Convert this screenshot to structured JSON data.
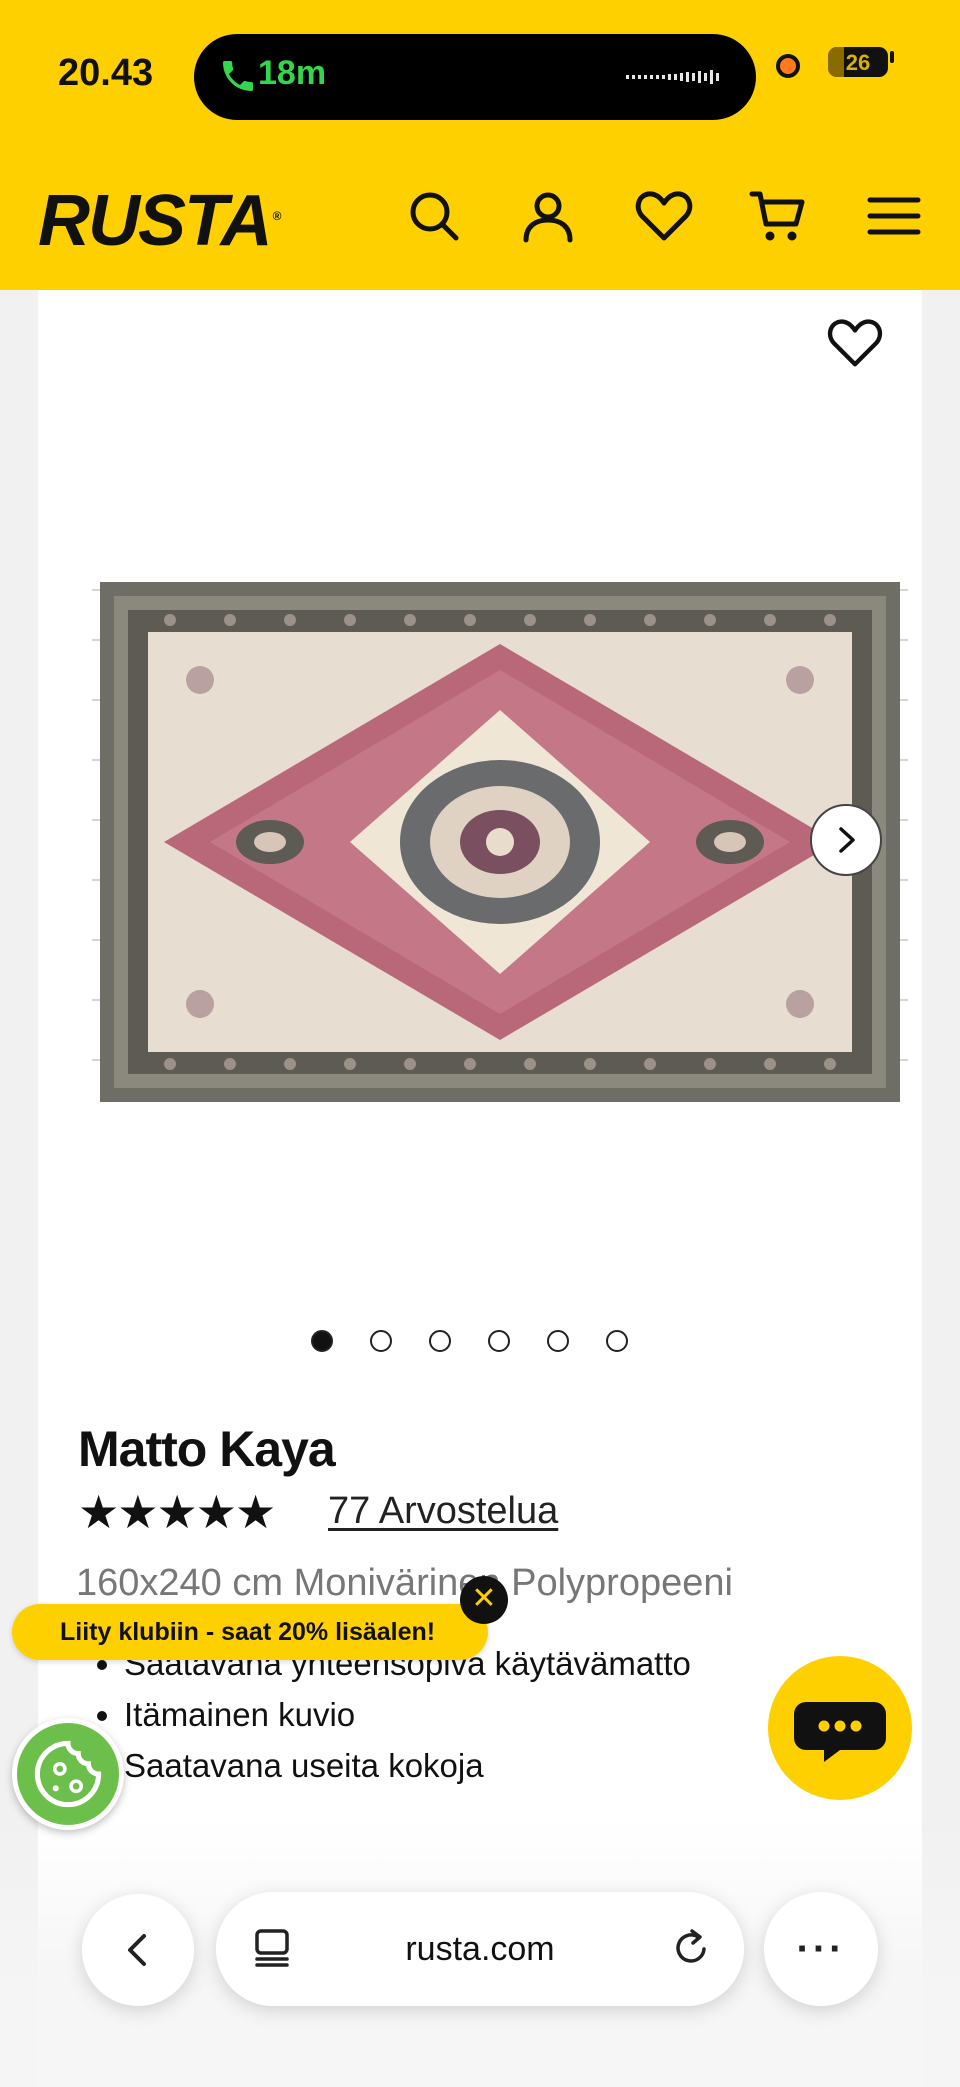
{
  "status_bar": {
    "time": "20.43",
    "call_duration": "18m",
    "battery": "26",
    "battery_level_percent": 26
  },
  "header": {
    "logo": "RUSTA",
    "logo_mark": "®",
    "icons": [
      "search-icon",
      "account-icon",
      "heart-icon",
      "cart-icon",
      "menu-icon"
    ]
  },
  "gallery": {
    "image_count": 6,
    "active_index": 0
  },
  "product": {
    "title": "Matto Kaya",
    "stars": "★★★★★",
    "rating": 5,
    "reviews_link": "77 Arvostelua",
    "subtitle": "160x240 cm Monivärinen Polypropeeni",
    "features": [
      "Saatavana yhteensopiva käytävämatto",
      "Itämainen kuvio",
      "Saatavana useita kokoja"
    ]
  },
  "promo": {
    "text": "Liity klubiin - saat 20% lisäalen!",
    "close": "✕"
  },
  "browser": {
    "url": "rusta.com",
    "more": "···"
  },
  "colors": {
    "brand_yellow": "#ffd000",
    "text": "#111111",
    "muted": "#777777",
    "cookie_green": "#6dbf4c"
  }
}
